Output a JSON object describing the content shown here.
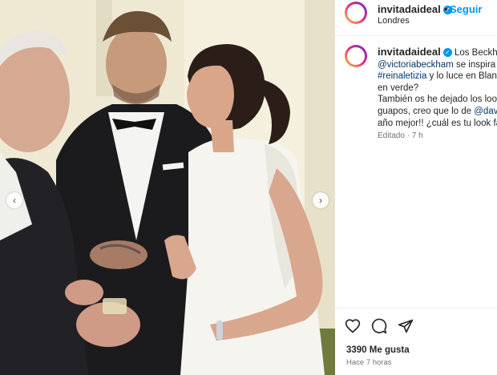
{
  "post": {
    "username": "invitadaideal",
    "follow_label": "Seguir",
    "separator": "•",
    "location": "Londres",
    "caption_lines": [
      {
        "pre": "",
        "user": "invitadaideal",
        "text": " Los Beckham"
      },
      {
        "link": "@victoriabeckham",
        "text": " se inspira e"
      },
      {
        "link": "#reinaletizia",
        "text": " y lo luce en Blanc"
      },
      {
        "text": "en verde?"
      },
      {
        "text": "También os he dejado los look"
      },
      {
        "text": "guapos, creo que lo de ",
        "link": "@davi"
      },
      {
        "text": "año mejor!! ¿cuál es tu look fa"
      }
    ],
    "edited": "Editado · 7 h",
    "likes": "3390 Me gusta",
    "time_ago": "Hace 7 horas"
  },
  "icons": {
    "verified": "verified-badge-icon",
    "like": "heart-icon",
    "comment": "comment-icon",
    "share": "share-icon",
    "prev": "chevron-left-icon",
    "next": "chevron-right-icon"
  },
  "nav": {
    "prev_glyph": "‹",
    "next_glyph": "›"
  },
  "colors": {
    "accent": "#0095f6",
    "link": "#00376b",
    "muted": "#737373"
  }
}
